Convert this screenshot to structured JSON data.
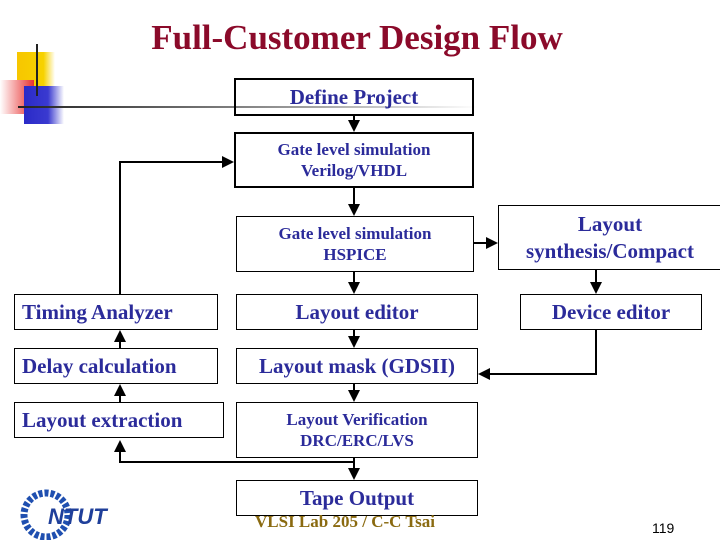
{
  "title": "Full-Customer Design Flow",
  "boxes": {
    "define_project": "Define Project",
    "gate_verilog_1": "Gate level simulation",
    "gate_verilog_2": "Verilog/VHDL",
    "gate_hspice_1": "Gate level simulation",
    "gate_hspice_2": "HSPICE",
    "layout_synth_1": "Layout",
    "layout_synth_2": "synthesis/Compact",
    "timing_analyzer": "Timing Analyzer",
    "layout_editor": "Layout editor",
    "device_editor": "Device editor",
    "delay_calculation": "Delay calculation",
    "layout_mask": "Layout mask (GDSII)",
    "layout_extraction": "Layout extraction",
    "layout_verification_1": "Layout Verification",
    "layout_verification_2": "DRC/ERC/LVS",
    "tape_output": "Tape Output"
  },
  "footer": "VLSI Lab 205 / C-C Tsai",
  "page_number": "119",
  "colors": {
    "title": "#8b0a2a",
    "box_text": "#2b2b9a",
    "footer": "#8a6a10"
  }
}
